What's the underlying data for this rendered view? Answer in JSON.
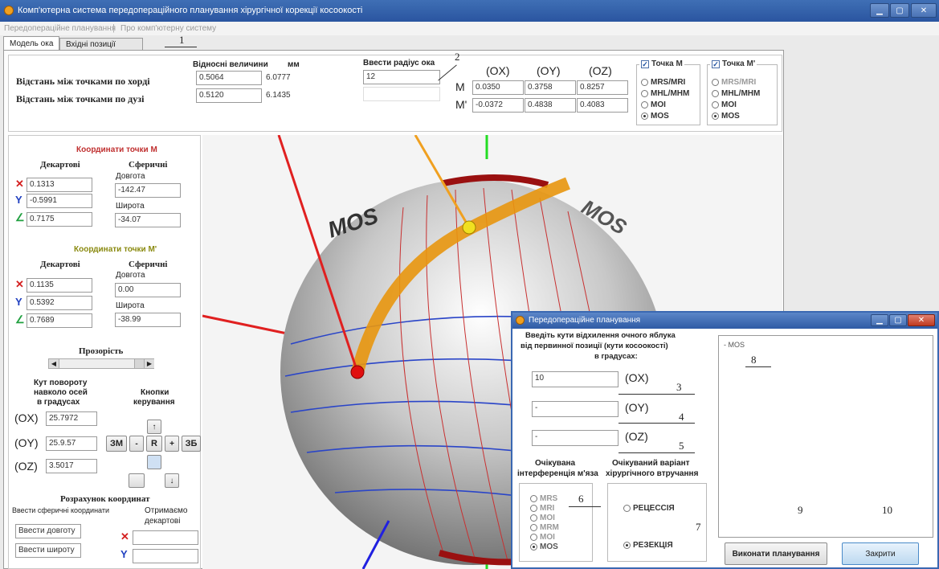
{
  "window": {
    "title": "Комп'ютерна система передопераційного планування хірургічної корекції косоокості",
    "menu": [
      "Передопераційне планування",
      "Про комп'ютерну систему"
    ]
  },
  "tabs": [
    "Модель ока",
    "Вхідні позиції"
  ],
  "top": {
    "row1_label": "Відстань між точками по хорді",
    "row2_label": "Відстань між точками по дузі",
    "col_relative": "Відносні величини",
    "col_mm": "мм",
    "col_radius": "Ввести радіус ока",
    "rel_chord": "0.5064",
    "rel_arc": "0.5120",
    "mm_chord": "6.0777",
    "mm_arc": "6.1435",
    "radius": "12",
    "radius2": "",
    "head_ox": "(OX)",
    "head_oy": "(OY)",
    "head_oz": "(OZ)",
    "row_m": "M",
    "row_mp": "M'",
    "m_ox": "0.0350",
    "m_oy": "0.3758",
    "m_oz": "0.8257",
    "mp_ox": "-0.0372",
    "mp_oy": "0.4838",
    "mp_oz": "0.4083",
    "group_m": "Точка М",
    "group_mp": "Точка М'",
    "options": [
      "MRS/MRI",
      "MHL/MHM",
      "MOI",
      "MOS"
    ]
  },
  "left": {
    "title_m": "Координати точки М",
    "title_mp": "Координати точки М'",
    "cart": "Декартові",
    "sph": "Сферичні",
    "longitude": "Довгота",
    "latitude": "Широта",
    "m_x": "0.1313",
    "m_y": "-0.5991",
    "m_z": "0.7175",
    "m_lon": "-142.47",
    "m_lat": "-34.07",
    "mp_x": "0.1135",
    "mp_y": "0.5392",
    "mp_z": "0.7689",
    "mp_lon": "0.00",
    "mp_lat": "-38.99",
    "transparency": "Прозорість",
    "rot_title_1": "Кут повороту",
    "rot_title_2": "навколо осей",
    "rot_title_3": "в градусах",
    "ctrl_title_1": "Кнопки",
    "ctrl_title_2": "керування",
    "ox_label": "(OX)",
    "oy_label": "(OY)",
    "oz_label": "(OZ)",
    "rot_ox": "25.7972",
    "rot_oy": "25.9.57",
    "rot_oz": "3.5017",
    "btn_zm": "ЗМ",
    "btn_minus": "-",
    "btn_r": "R",
    "btn_plus": "+",
    "btn_zb": "ЗБ",
    "btn_up": "↑",
    "btn_down": "↓",
    "calc_title": "Розрахунок координат",
    "calc_in": "Ввести сферичні координати",
    "calc_out_1": "Отримаємо",
    "calc_out_2": "декартові",
    "in_lon": "Ввести довготу",
    "in_lat": "Ввести широту"
  },
  "sphere": {
    "label1": "MOS",
    "label2": "MOS"
  },
  "dialog": {
    "title": "Передопераційне планування",
    "prompt_1": "Введіть кути відхилення очного яблука",
    "prompt_2": "від первинної позиції (кути косоокості)",
    "prompt_3": "в градусах:",
    "val_ox": "10",
    "val_oy": "-",
    "val_oz": "-",
    "lab_ox": "(OX)",
    "lab_oy": "(OY)",
    "lab_oz": "(OZ)",
    "muscle_title_1": "Очікувана",
    "muscle_title_2": "інтерференція м'яза",
    "variant_title_1": "Очікуваний варіант",
    "variant_title_2": "хірургічного втручання",
    "muscles": [
      "MRS",
      "MRI",
      "MOI",
      "MRM",
      "MOI",
      "MOS"
    ],
    "variant_1": "РЕЦЕССІЯ",
    "variant_2": "РЕЗЕКЦІЯ",
    "result_text": "- MOS",
    "btn_plan": "Виконати планування",
    "btn_close": "Закрити"
  },
  "annotations": [
    "1",
    "2",
    "3",
    "4",
    "5",
    "6",
    "7",
    "8",
    "9",
    "10"
  ]
}
